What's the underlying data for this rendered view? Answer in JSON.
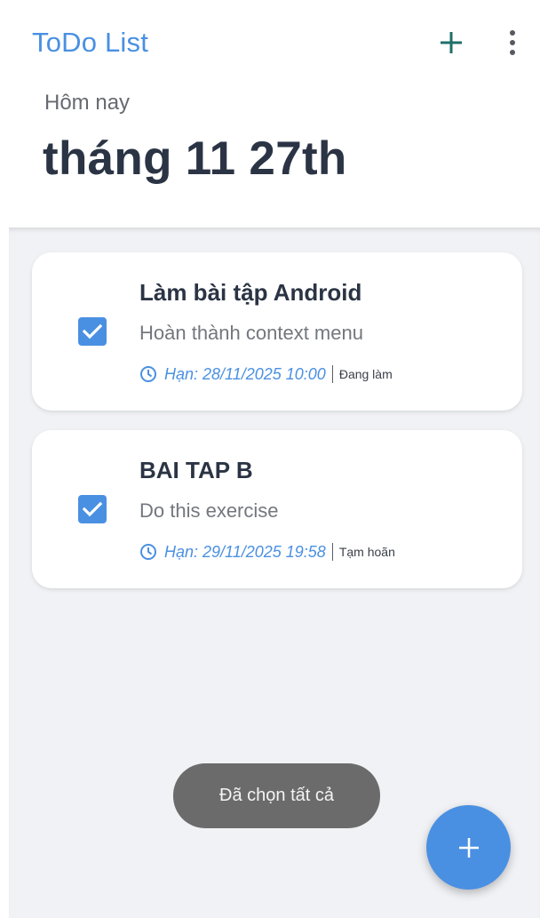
{
  "appbar": {
    "title": "ToDo List",
    "add_icon": "plus-icon",
    "more_icon": "more-vertical-icon"
  },
  "header": {
    "today_label": "Hôm nay",
    "date": "tháng 11 27th"
  },
  "tasks": [
    {
      "title": "Làm bài tập Android",
      "description": "Hoàn thành context menu",
      "deadline": "Hạn: 28/11/2025 10:00",
      "status": "Đang làm",
      "checked": true
    },
    {
      "title": "BAI TAP B",
      "description": "Do this exercise",
      "deadline": "Hạn: 29/11/2025 19:58",
      "status": "Tạm hoãn",
      "checked": true
    }
  ],
  "toast": {
    "message": "Đã chọn tất cả"
  },
  "fab": {
    "icon": "plus-icon"
  },
  "colors": {
    "accent": "#4a90e2",
    "title_text": "#2b3444",
    "list_background": "#f1f2f5",
    "toast_background": "#6b6b6b"
  }
}
